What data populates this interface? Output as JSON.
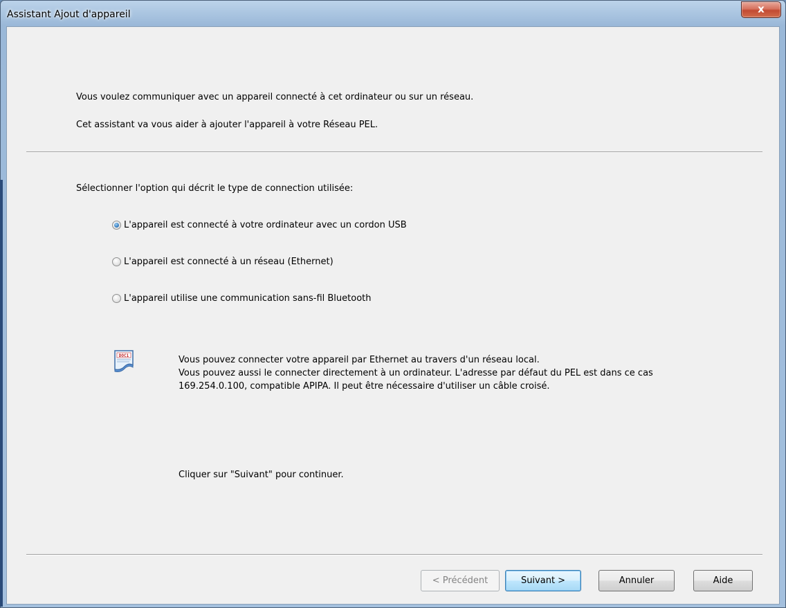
{
  "window": {
    "title": "Assistant Ajout d'appareil",
    "close_symbol": "x"
  },
  "intro": {
    "line1": "Vous voulez communiquer avec un appareil connecté à cet ordinateur ou sur un réseau.",
    "line2": "Cet assistant va vous aider à ajouter l'appareil à votre Réseau PEL."
  },
  "selection": {
    "label": "Sélectionner l'option qui décrit le type de connection utilisée:",
    "options": [
      {
        "label": "L'appareil est connecté à votre ordinateur avec un cordon USB",
        "selected": true
      },
      {
        "label": "L'appareil est connecté à un réseau (Ethernet)",
        "selected": false
      },
      {
        "label": "L'appareil utilise une communication sans-fil Bluetooth",
        "selected": false
      }
    ]
  },
  "info": {
    "icon": "document-icon",
    "icon_text": "DOC1",
    "line1": "Vous pouvez connecter votre appareil par Ethernet  au travers d'un réseau local.",
    "line2": "Vous pouvez aussi le connecter directement à un ordinateur. L'adresse par défaut du PEL est dans ce cas",
    "line3": "169.254.0.100, compatible APIPA. Il peut être nécessaire d'utiliser un câble croisé."
  },
  "continue_text": "Cliquer sur \"Suivant\" pour continuer.",
  "buttons": {
    "previous": "< Précédent",
    "next": "Suivant >",
    "cancel": "Annuler",
    "help": "Aide"
  }
}
